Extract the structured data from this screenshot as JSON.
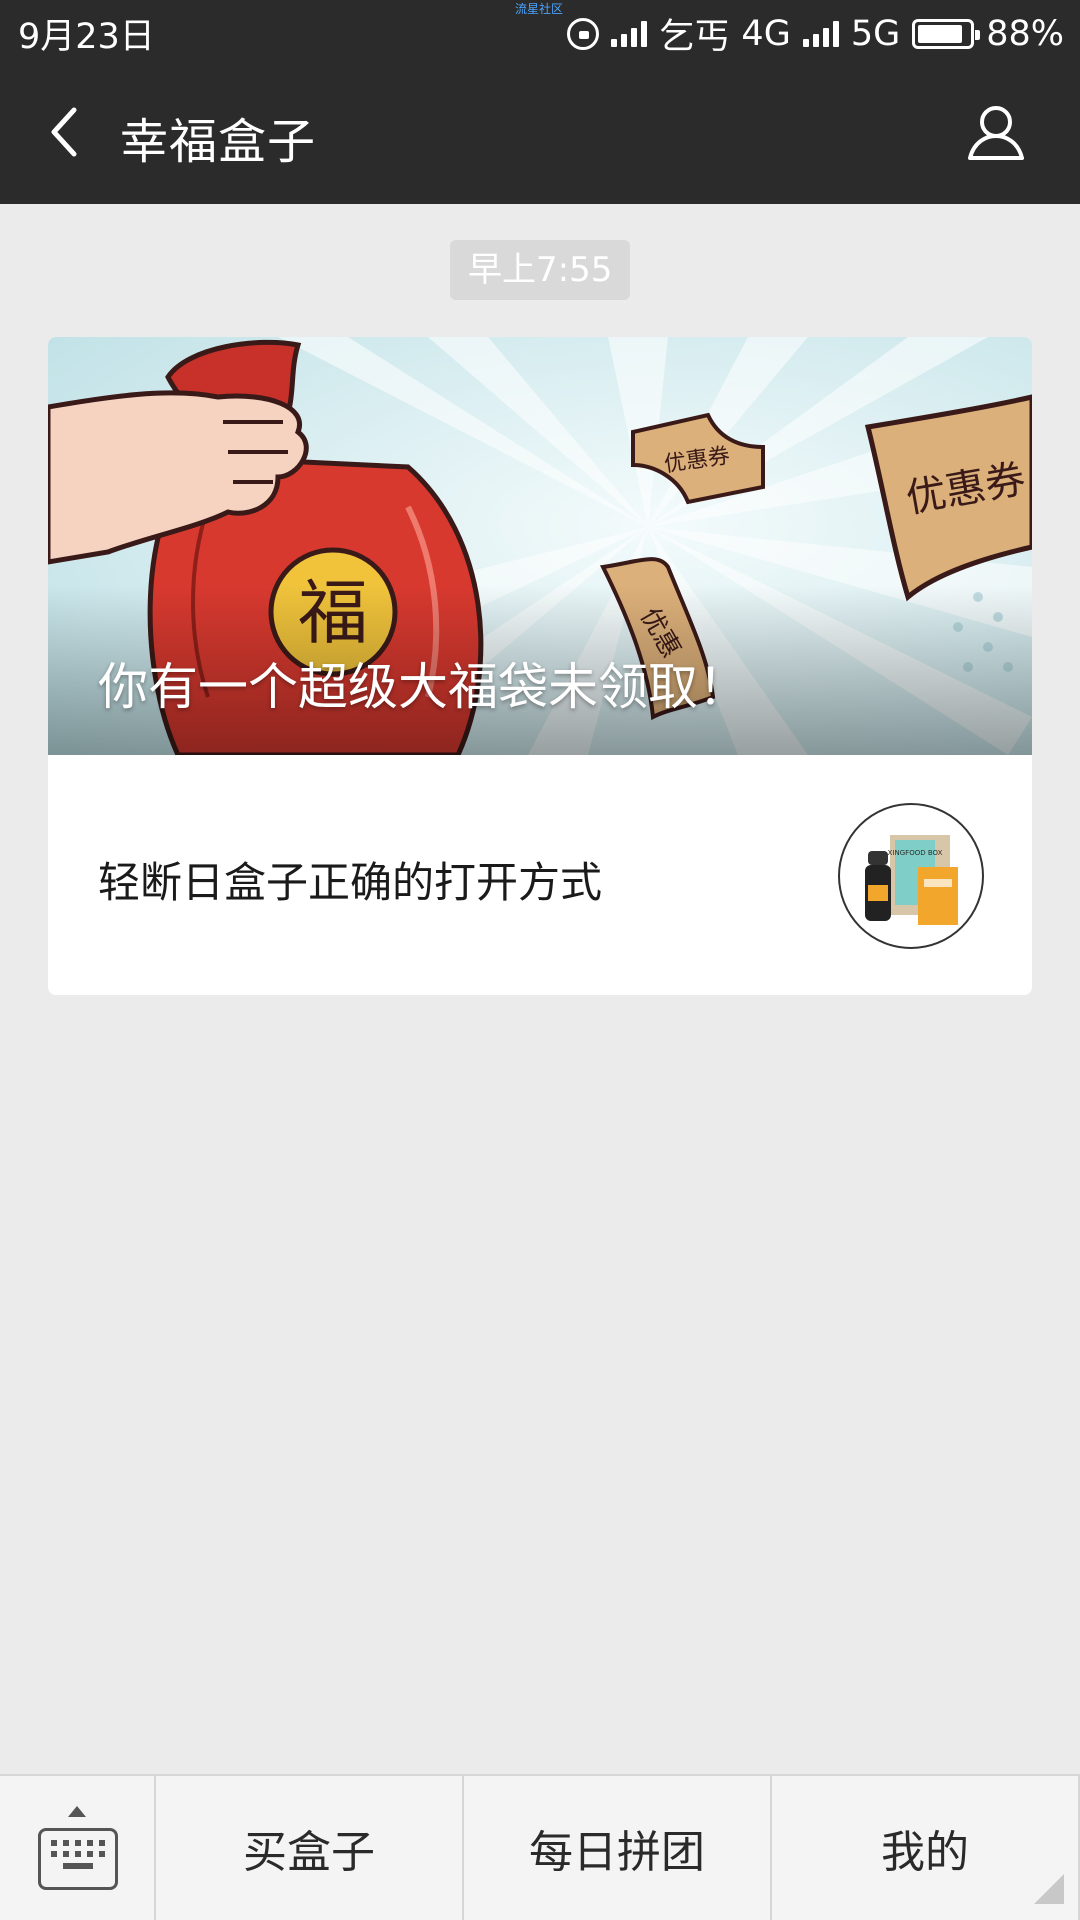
{
  "status": {
    "date": "9月23日",
    "watermark": "流星社区",
    "carrier": "乞丐",
    "network1": "4G",
    "network2": "5G",
    "battery_percent": "88%",
    "battery_level": 0.88
  },
  "nav": {
    "title": "幸福盒子",
    "back_icon": "chevron-left-icon",
    "profile_icon": "user-profile-icon"
  },
  "chat": {
    "timestamp": "早上7:55"
  },
  "card": {
    "banner_title": "你有一个超级大福袋未领取！",
    "banner_art": {
      "bag_char": "福",
      "coupon_label": "优惠券",
      "coupon_label_short": "优惠"
    },
    "item_title": "轻断日盒子正确的打开方式",
    "thumb_text": "XINGFOOD BOX"
  },
  "bottom_menu": {
    "keyboard_icon": "keyboard-icon",
    "items": [
      "买盒子",
      "每日拼团",
      "我的"
    ]
  },
  "colors": {
    "header_bg": "#2b2b2b",
    "page_bg": "#ebebeb",
    "bag_red": "#d8392f",
    "coupon_tan": "#dcb07a"
  }
}
